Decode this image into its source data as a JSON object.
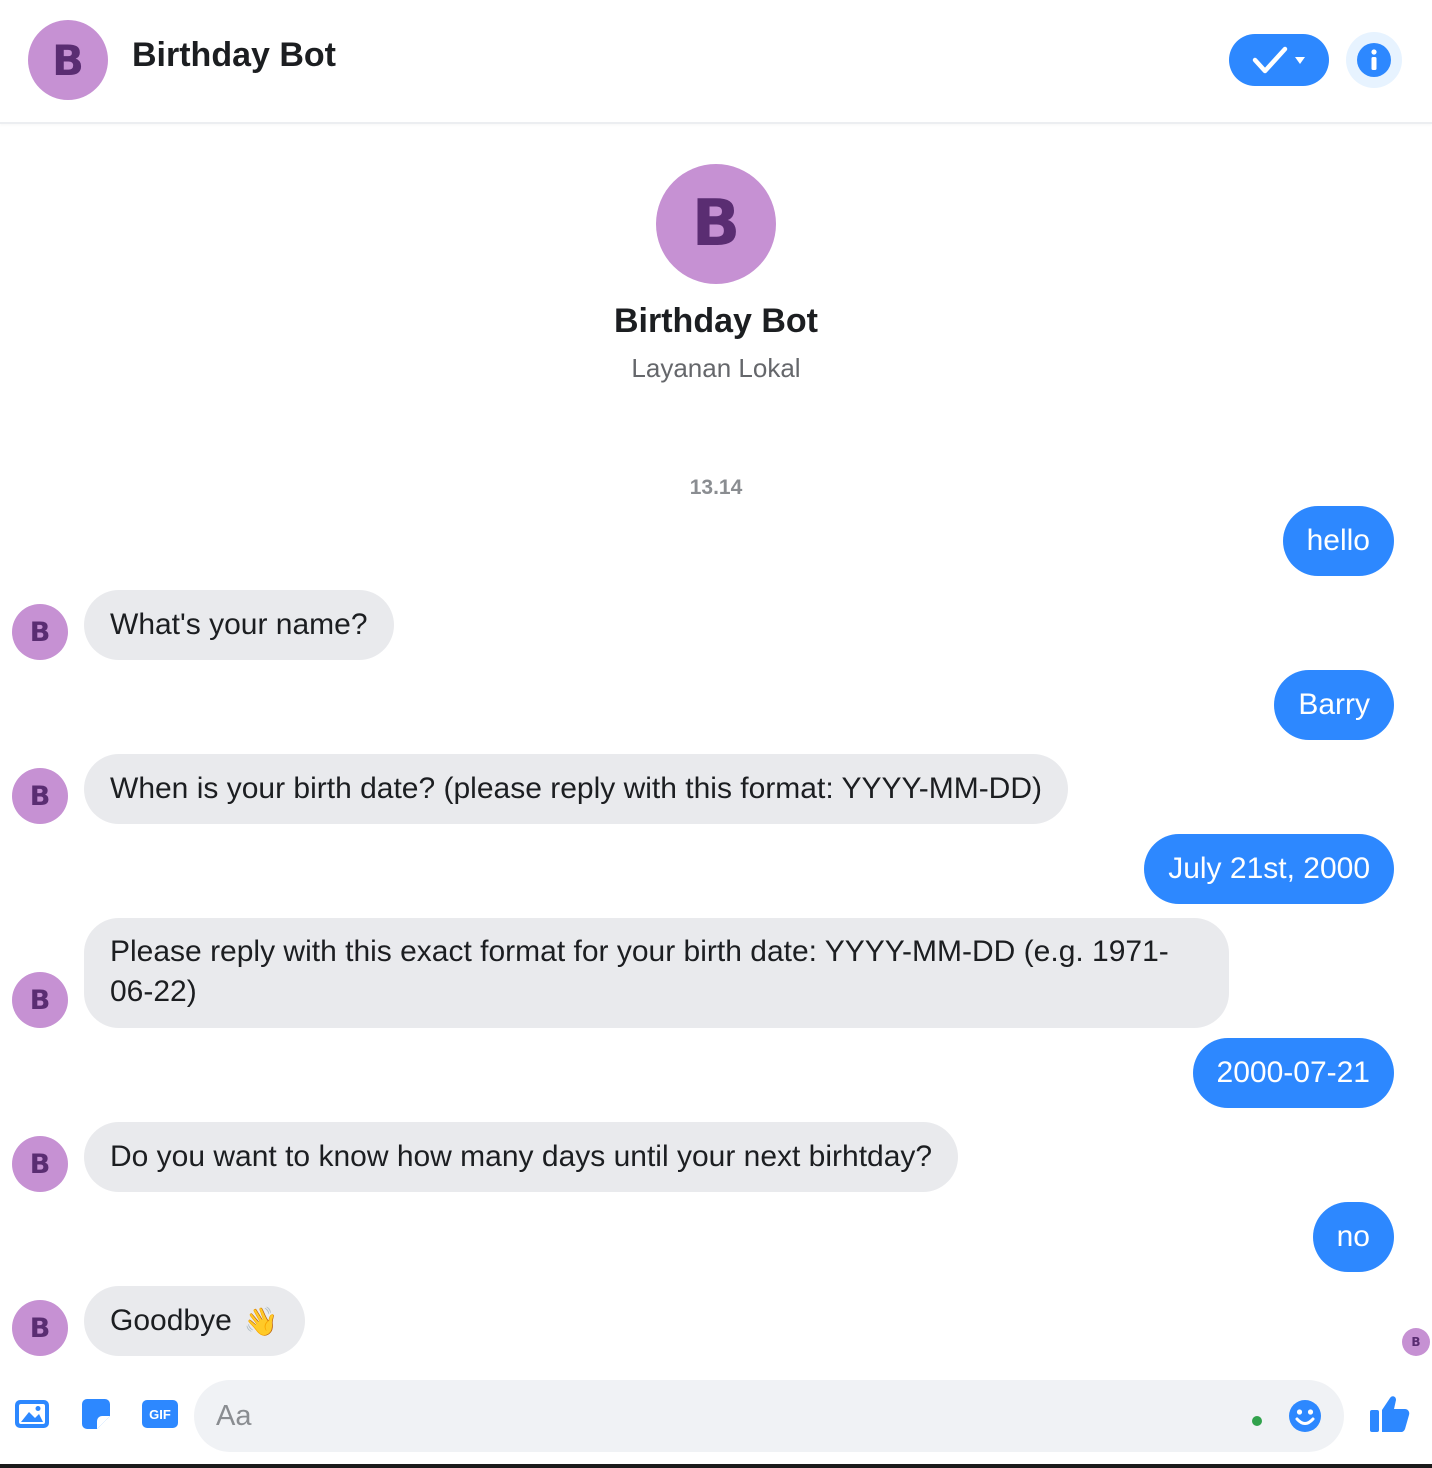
{
  "header": {
    "avatar_letter": "B",
    "title": "Birthday Bot"
  },
  "profile": {
    "avatar_letter": "B",
    "name": "Birthday Bot",
    "subtitle": "Layanan Lokal"
  },
  "timestamp": "13.14",
  "bot_avatar_letter": "B",
  "messages": [
    {
      "from": "user",
      "text": "hello"
    },
    {
      "from": "bot",
      "text": "What's your name?"
    },
    {
      "from": "user",
      "text": "Barry"
    },
    {
      "from": "bot",
      "text": "When is your birth date? (please reply with this format: YYYY-MM-DD)"
    },
    {
      "from": "user",
      "text": "July 21st, 2000"
    },
    {
      "from": "bot",
      "text": "Please reply with this exact format for your birth date: YYYY-MM-DD (e.g. 1971-06-22)"
    },
    {
      "from": "user",
      "text": "2000-07-21"
    },
    {
      "from": "bot",
      "text": "Do you want to know how many days until your next birhtday?"
    },
    {
      "from": "user",
      "text": "no"
    },
    {
      "from": "bot",
      "text": "Goodbye",
      "emoji": "👋"
    }
  ],
  "seen_avatar_letter": "B",
  "composer": {
    "placeholder": "Aa",
    "gif_label": "GIF"
  },
  "colors": {
    "accent": "#2d88ff",
    "avatar_bg": "#c691d3",
    "avatar_fg": "#5a2d72",
    "bot_bubble": "#e9eaed"
  },
  "icons": [
    "check-icon",
    "info-icon",
    "image-icon",
    "sticker-icon",
    "gif-icon",
    "emoji-icon",
    "thumbs-up-icon"
  ]
}
